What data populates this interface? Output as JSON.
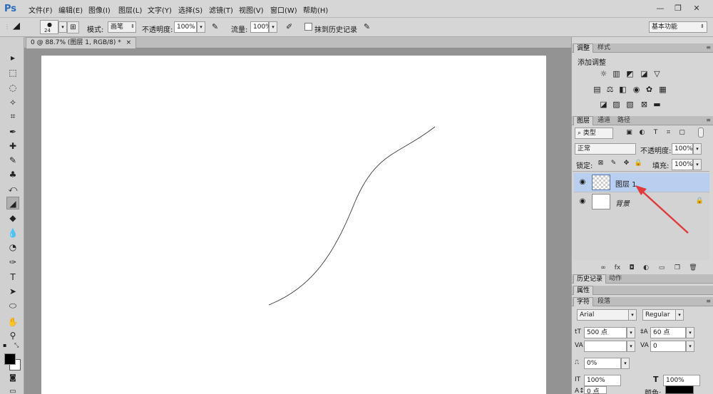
{
  "app": {
    "logo": "Ps"
  },
  "menu": [
    "文件(F)",
    "编辑(E)",
    "图像(I)",
    "图层(L)",
    "文字(Y)",
    "选择(S)",
    "滤镜(T)",
    "视图(V)",
    "窗口(W)",
    "帮助(H)"
  ],
  "window_controls": {
    "minimize": "—",
    "restore": "❐",
    "close": "✕"
  },
  "options": {
    "brush_size": "24",
    "mode_label": "模式:",
    "mode_value": "画笔",
    "opacity_label": "不透明度:",
    "opacity_value": "100%",
    "flow_label": "流量:",
    "flow_value": "100%",
    "erase_history_label": "抹到历史记录",
    "erase_history_checked": false,
    "workspace": "基本功能"
  },
  "document": {
    "tab_title": "0 @ 88.7% (图层 1, RGB/8) *",
    "tab_close": "×"
  },
  "panels": {
    "adjust_tabs": [
      "调整",
      "样式"
    ],
    "adjust_title": "添加调整",
    "layers_tabs": [
      "图层",
      "通道",
      "路径"
    ],
    "filter_kind": "类型",
    "blend_mode": "正常",
    "opacity_label": "不透明度:",
    "opacity_value": "100%",
    "lock_label": "锁定:",
    "fill_label": "填充:",
    "fill_value": "100%",
    "layers": [
      {
        "name": "图层 1",
        "selected": true,
        "transparent": true
      },
      {
        "name": "背景",
        "selected": false,
        "transparent": false,
        "locked": true
      }
    ],
    "history_tabs": [
      "历史记录",
      "动作"
    ],
    "properties_tab": "属性",
    "char_tabs": [
      "字符",
      "段落"
    ],
    "font_family": "Arial",
    "font_style": "Regular",
    "font_size": "500 点",
    "leading": "60 点",
    "tracking": "0",
    "scale_percent": "0%",
    "vert_scale": "100%",
    "horiz_scale": "100%",
    "baseline": "0 点",
    "color_label": "颜色:"
  },
  "colors": {
    "selected_layer": "#b9cff0",
    "annotation_arrow": "#e03a3a",
    "foreground": "#000000",
    "background": "#ffffff"
  }
}
